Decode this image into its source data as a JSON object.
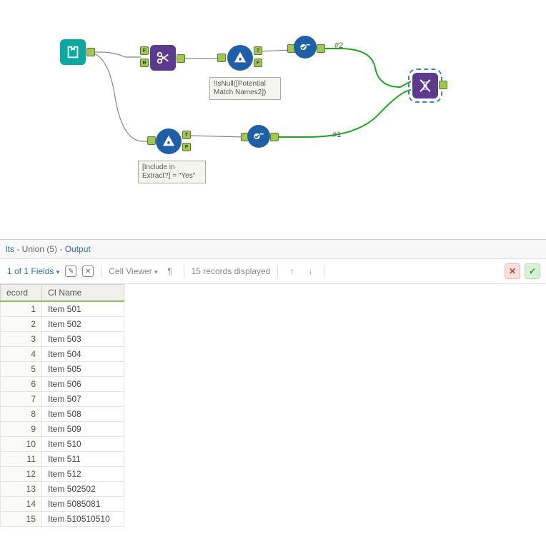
{
  "canvas": {
    "annotations": {
      "filter_top": "!IsNull([Potential Match Names2])",
      "filter_bottom": "[Include in Extract?] = \"Yes\""
    },
    "labels": {
      "conn1": "#1",
      "conn2": "#2"
    }
  },
  "results": {
    "header_prefix": "lts",
    "header_mid": " - Union (5) - ",
    "header_suffix": "Output",
    "fields_label": "1 of 1 Fields",
    "cell_viewer": "Cell Viewer",
    "records_displayed": "15 records displayed",
    "columns": {
      "record": "ecord",
      "ci_name": "CI Name"
    },
    "rows": [
      {
        "rec": "1",
        "val": "Item 501"
      },
      {
        "rec": "2",
        "val": "Item 502"
      },
      {
        "rec": "3",
        "val": "Item 503"
      },
      {
        "rec": "4",
        "val": "Item 504"
      },
      {
        "rec": "5",
        "val": "Item 505"
      },
      {
        "rec": "6",
        "val": "Item 506"
      },
      {
        "rec": "7",
        "val": "Item 507"
      },
      {
        "rec": "8",
        "val": "Item 508"
      },
      {
        "rec": "9",
        "val": "Item 509"
      },
      {
        "rec": "10",
        "val": "Item 510"
      },
      {
        "rec": "11",
        "val": "Item 511"
      },
      {
        "rec": "12",
        "val": "Item 512"
      },
      {
        "rec": "13",
        "val": "Item 502502"
      },
      {
        "rec": "14",
        "val": "Item 5085081"
      },
      {
        "rec": "15",
        "val": "Item 510510510"
      }
    ]
  }
}
